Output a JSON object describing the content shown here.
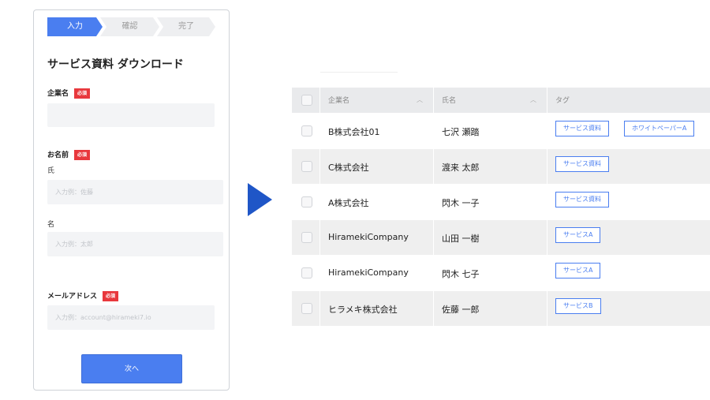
{
  "form": {
    "steps": [
      "入力",
      "確認",
      "完了"
    ],
    "title": "サービス資料 ダウンロード",
    "required_badge": "必須",
    "company_label": "企業名",
    "company_value": "",
    "name_label": "お名前",
    "last_name_label": "氏",
    "last_name_placeholder": "入力例：佐藤",
    "first_name_label": "名",
    "first_name_placeholder": "入力例：太郎",
    "email_label": "メールアドレス",
    "email_placeholder": "入力例：account@hirameki7.io",
    "next_button": "次へ"
  },
  "table": {
    "headers": {
      "company": "企業名",
      "name": "氏名",
      "tags": "タグ"
    },
    "rows": [
      {
        "company": "B株式会社01",
        "name": "七沢 瀬踏",
        "tags": [
          "サービス資料",
          "ホワイトペーパーA"
        ]
      },
      {
        "company": "C株式会社",
        "name": "渡来 太郎",
        "tags": [
          "サービス資料"
        ]
      },
      {
        "company": "A株式会社",
        "name": "閃木 一子",
        "tags": [
          "サービス資料"
        ]
      },
      {
        "company": "HiramekiCompany",
        "name": "山田 一樹",
        "tags": [
          "サービスA"
        ]
      },
      {
        "company": "HiramekiCompany",
        "name": "閃木 七子",
        "tags": [
          "サービスA"
        ]
      },
      {
        "company": "ヒラメキ株式会社",
        "name": "佐藤 一郎",
        "tags": [
          "サービスB"
        ]
      }
    ]
  },
  "colors": {
    "accent": "#4a7ef0",
    "arrow": "#1f56c7",
    "required": "#e8383d"
  }
}
